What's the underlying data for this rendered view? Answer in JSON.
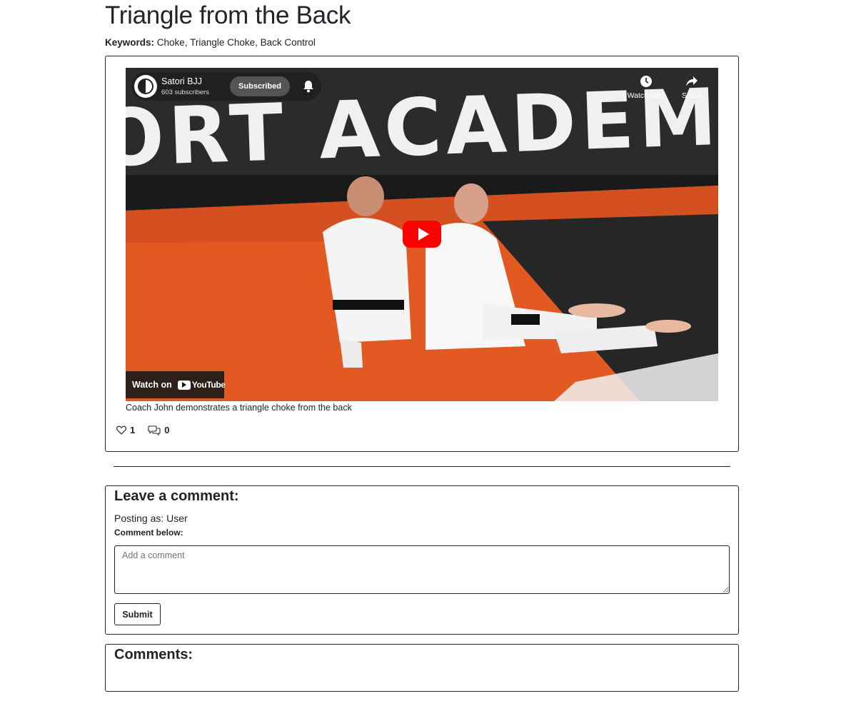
{
  "post": {
    "title": "Triangle from the Back",
    "keywords_label": "Keywords:",
    "keywords": "Choke, Triangle Choke, Back Control",
    "caption": "Coach John demonstrates a triangle choke from the back",
    "likes": "1",
    "comments_count": "0"
  },
  "video": {
    "channel_name": "Satori BJJ",
    "subscribers": "603 subscribers",
    "subscribed_label": "Subscribed",
    "watch_later_label": "Watch later",
    "share_label": "Share",
    "watch_on_label": "Watch on",
    "youtube_label": "YouTube",
    "banner_text": "ORT ACADEMY",
    "play_color": "#ff0000"
  },
  "comment_form": {
    "heading": "Leave a comment:",
    "posting_as": "Posting as: User",
    "label": "Comment below:",
    "placeholder": "Add a comment",
    "submit_label": "Submit"
  },
  "comments": {
    "heading": "Comments:"
  }
}
